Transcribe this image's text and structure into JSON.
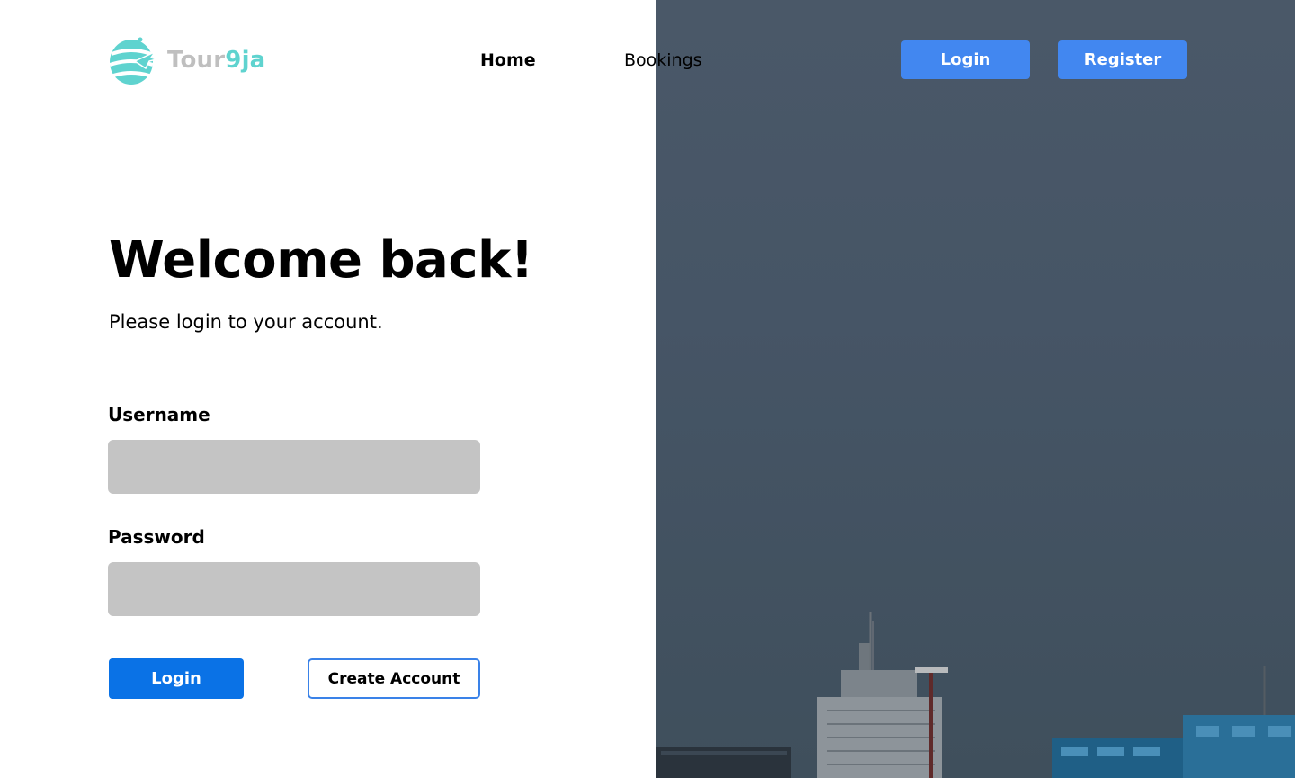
{
  "brand": {
    "name_part1": "Tour",
    "name_part2": "9ja",
    "colors": {
      "grey": "#bfbfbf",
      "teal": "#5fd3cf"
    }
  },
  "nav": {
    "home": "Home",
    "bookings": "Bookings"
  },
  "header_buttons": {
    "login": "Login",
    "register": "Register"
  },
  "hero": {
    "title": "Welcome back!",
    "subtitle": "Please login to your account."
  },
  "form": {
    "username_label": "Username",
    "username_value": "",
    "username_placeholder": "",
    "password_label": "Password",
    "password_value": "",
    "password_placeholder": "",
    "login_button": "Login",
    "create_account_button": "Create Account"
  },
  "icons": {
    "logo": "globe-plane-icon"
  },
  "colors": {
    "primary": "#4287f0",
    "login_button": "#0a72e6",
    "input_bg": "#c4c4c4",
    "photo_sky": "#465566"
  }
}
